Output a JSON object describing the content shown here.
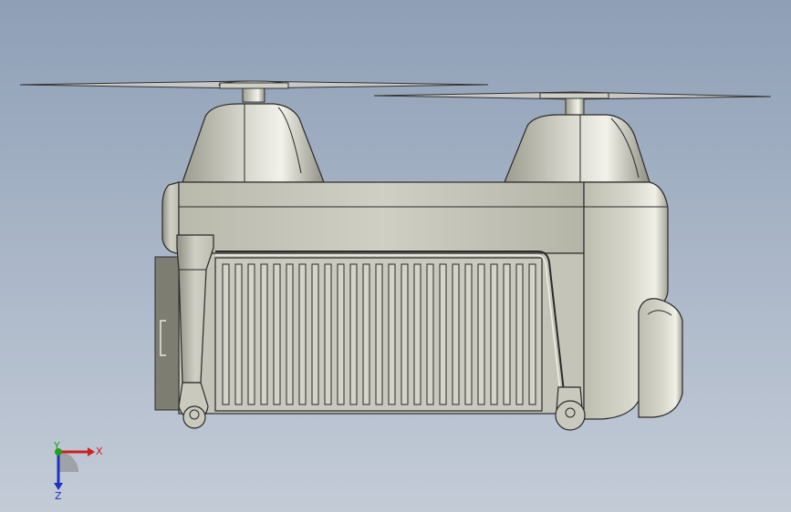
{
  "triad": {
    "x_label": "X",
    "y_label": "Y",
    "z_label": "Z"
  },
  "colors": {
    "background_top": "#8e9fb6",
    "background_bottom": "#c3cbd7",
    "body_fill": "#c9c9bd",
    "edge": "#2a2a2a",
    "axis_x": "#d02020",
    "axis_y": "#20a020",
    "axis_z": "#2030c0"
  }
}
